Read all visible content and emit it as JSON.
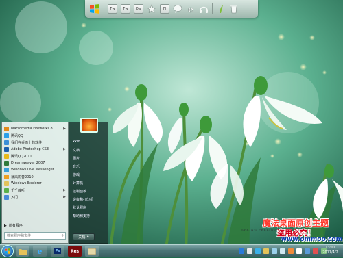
{
  "dock": {
    "icons": [
      "windows-logo",
      "fireworks-icon",
      "photoshop-icon",
      "dreamweaver-icon",
      "star-icon",
      "flash-icon",
      "chat-icon",
      "ie-icon",
      "headphones-icon",
      "leaf-icon",
      "bin-icon"
    ],
    "labels": [
      "Fw",
      "Fw",
      "Dw",
      "Fl"
    ]
  },
  "start_menu": {
    "programs": [
      {
        "label": "Macromedia Fireworks 8",
        "color": "#e28a1a",
        "arrow": true
      },
      {
        "label": "腾讯QQ",
        "color": "#2aa0e8",
        "arrow": false
      },
      {
        "label": "我们在桌面上的软件",
        "color": "#3a8fd8",
        "arrow": false
      },
      {
        "label": "Adobe Photoshop CS3",
        "color": "#1a5fae",
        "arrow": true
      },
      {
        "label": "腾讯QQ2011",
        "color": "#e8b91a",
        "arrow": false
      },
      {
        "label": "Dreamweaver 2007",
        "color": "#2f7a3a",
        "arrow": false
      },
      {
        "label": "Windows Live Messenger",
        "color": "#39a0d8",
        "arrow": false
      },
      {
        "label": "暴风影音2010",
        "color": "#f0a020",
        "arrow": false
      },
      {
        "label": "Windows Explorer",
        "color": "#e3c35a",
        "arrow": false
      },
      {
        "label": "千千静听",
        "color": "#5ab04a",
        "arrow": true
      },
      {
        "label": "入门",
        "color": "#4a8ad8",
        "arrow": true
      }
    ],
    "all_programs": "所有程序",
    "search_placeholder": "搜索程序和文件",
    "right_items": [
      "xxm",
      "文档",
      "图片",
      "音乐",
      "游戏",
      "计算机",
      "控制面板",
      "设备和打印机",
      "默认程序",
      "帮助和支持"
    ],
    "shutdown": "关机"
  },
  "watermark": {
    "title": "魔法桌面原创主题",
    "subtitle": "盗用必究！",
    "url": "www.ommoo.com",
    "caption": "SPRING FEELINGS"
  },
  "taskbar": {
    "apps": [
      "folder",
      "ie",
      "photoshop",
      "recorder",
      "explorer"
    ],
    "recorder_label": "Res",
    "time": "13:01",
    "date": "2011/4/2"
  }
}
